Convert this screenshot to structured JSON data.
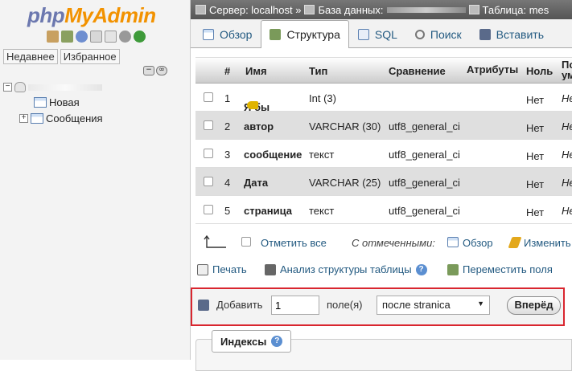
{
  "nav": {
    "logo_php": "php",
    "logo_myadmin": "MyAdmin",
    "tabs": [
      "Недавнее",
      "Избранное"
    ],
    "tree": {
      "new_label": "Новая",
      "table_label": "Сообщения"
    },
    "icons": [
      "home-icon",
      "exit-icon",
      "help-icon",
      "docs-icon",
      "copy-icon",
      "settings-icon",
      "reload-icon"
    ]
  },
  "breadcrumb": {
    "server": "Сервер: localhost »",
    "database": "База данных:",
    "table": "Таблица: mes"
  },
  "tabs": [
    {
      "label": "Обзор",
      "icon": "browse-icon"
    },
    {
      "label": "Структура",
      "icon": "structure-icon"
    },
    {
      "label": "SQL",
      "icon": "sql-icon"
    },
    {
      "label": "Поиск",
      "icon": "search-icon"
    },
    {
      "label": "Вставить",
      "icon": "insert-icon"
    }
  ],
  "columns": {
    "num": "#",
    "name": "Имя",
    "type": "Тип",
    "collation": "Сравнение",
    "attributes": "Атрибуты",
    "null": "Ноль",
    "default": "По ум"
  },
  "rows": [
    {
      "num": "1",
      "name": "Я бы",
      "type": "Int (3)",
      "collation": "",
      "null": "Нет",
      "default": "Не"
    },
    {
      "num": "2",
      "name": "автор",
      "type": "VARCHAR (30)",
      "collation": "utf8_general_ci",
      "null": "Нет",
      "default": "Не"
    },
    {
      "num": "3",
      "name": "сообщение",
      "type": "текст",
      "collation": "utf8_general_ci",
      "null": "Нет",
      "default": "Не"
    },
    {
      "num": "4",
      "name": "Дата",
      "type": "VARCHAR (25)",
      "collation": "utf8_general_ci",
      "null": "Нет",
      "default": "Не"
    },
    {
      "num": "5",
      "name": "страница",
      "type": "текст",
      "collation": "utf8_general_ci",
      "null": "Нет",
      "default": "Не"
    }
  ],
  "selection": {
    "check_all": "Отметить все",
    "with_selected": "С отмеченными:",
    "browse": "Обзор",
    "change": "Изменить"
  },
  "tools": {
    "print": "Печать",
    "analyze": "Анализ структуры таблицы",
    "move_columns": "Переместить поля"
  },
  "add_columns": {
    "label": "Добавить",
    "count": "1",
    "fields_label": "поле(я)",
    "position": "после stranica",
    "go": "Вперёд"
  },
  "indexes": {
    "label": "Индексы"
  },
  "colors": {
    "highlight_border": "#d9262f",
    "link": "#235a81",
    "logo_php": "#6c78af",
    "logo_myadmin": "#f29200"
  }
}
